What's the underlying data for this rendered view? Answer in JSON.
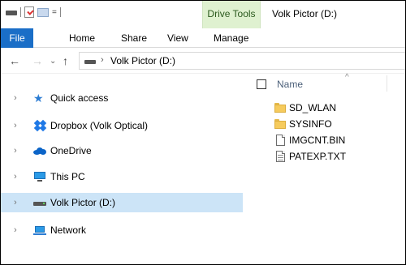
{
  "window": {
    "title": "Volk Pictor (D:)",
    "contextual_tab_group": "Drive Tools",
    "qat_dropdown_glyph": "="
  },
  "ribbon": {
    "tabs": [
      {
        "label": "File",
        "active": true
      },
      {
        "label": "Home"
      },
      {
        "label": "Share"
      },
      {
        "label": "View"
      },
      {
        "label": "Manage"
      }
    ]
  },
  "address": {
    "separator": "›",
    "path": "Volk Pictor (D:)"
  },
  "nav_pane": {
    "items": [
      {
        "label": "Quick access",
        "icon": "star-icon"
      },
      {
        "label": "Dropbox (Volk Optical)",
        "icon": "dropbox-icon"
      },
      {
        "label": "OneDrive",
        "icon": "onedrive-icon"
      },
      {
        "label": "This PC",
        "icon": "computer-icon"
      },
      {
        "label": "Volk Pictor (D:)",
        "icon": "drive-icon",
        "selected": true
      },
      {
        "label": "Network",
        "icon": "network-icon"
      }
    ]
  },
  "file_list": {
    "column_header": "Name",
    "items": [
      {
        "name": "SD_WLAN",
        "type": "folder"
      },
      {
        "name": "SYSINFO",
        "type": "folder"
      },
      {
        "name": "IMGCNT.BIN",
        "type": "file"
      },
      {
        "name": "PATEXP.TXT",
        "type": "text"
      }
    ]
  },
  "colors": {
    "file_tab": "#1a6ec7",
    "drive_tools": "#dff1d0",
    "selection": "#cce4f7",
    "folder": "#f6cb5d"
  }
}
